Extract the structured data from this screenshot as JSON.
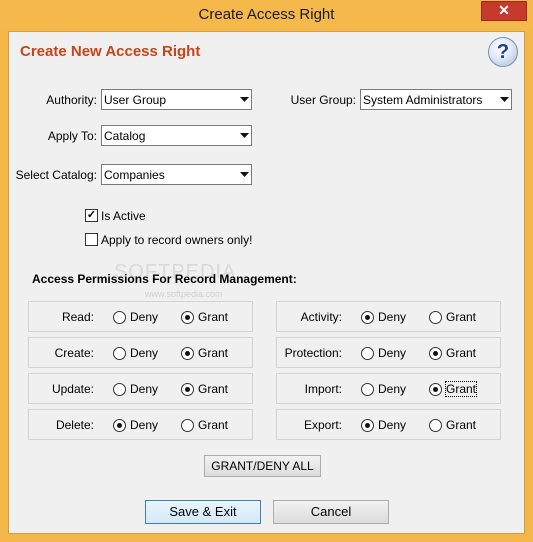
{
  "window": {
    "title": "Create Access Right",
    "close_label": "✕"
  },
  "dialog": {
    "heading": "Create New Access Right",
    "help_label": "?"
  },
  "form": {
    "authority": {
      "label": "Authority:",
      "value": "User Group"
    },
    "user_group": {
      "label": "User Group:",
      "value": "System Administrators"
    },
    "apply_to": {
      "label": "Apply To:",
      "value": "Catalog"
    },
    "select_catalog": {
      "label": "Select Catalog:",
      "value": "Companies"
    },
    "is_active": {
      "label": "Is Active",
      "checked": true
    },
    "owners_only": {
      "label": "Apply to record owners only!",
      "checked": false
    }
  },
  "permissions": {
    "title": "Access Permissions For Record Management:",
    "deny_label": "Deny",
    "grant_label": "Grant",
    "items": [
      {
        "name": "Read:",
        "value": "Grant"
      },
      {
        "name": "Create:",
        "value": "Grant"
      },
      {
        "name": "Update:",
        "value": "Grant"
      },
      {
        "name": "Delete:",
        "value": "Deny"
      },
      {
        "name": "Activity:",
        "value": "Deny"
      },
      {
        "name": "Protection:",
        "value": "Grant"
      },
      {
        "name": "Import:",
        "value": "Grant"
      },
      {
        "name": "Export:",
        "value": "Deny"
      }
    ]
  },
  "buttons": {
    "grant_deny_all": "GRANT/DENY ALL",
    "save_exit": "Save & Exit",
    "cancel": "Cancel"
  },
  "watermark": {
    "line1": "SOFTPEDIA",
    "line2": "www.softpedia.com"
  }
}
